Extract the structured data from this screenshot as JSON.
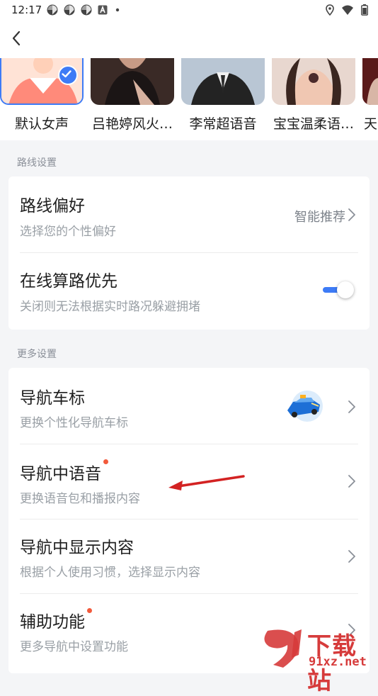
{
  "status_bar": {
    "time": "12:17",
    "left_icons": [
      "pinwheel-icon",
      "pinwheel-icon",
      "pinwheel-icon",
      "a-square-icon",
      "dot-icon"
    ],
    "right_icons": [
      "location-icon",
      "wifi-icon",
      "battery-icon"
    ]
  },
  "voices": [
    {
      "label": "默认女声",
      "selected": true
    },
    {
      "label": "吕艳婷风火…",
      "selected": false
    },
    {
      "label": "李常超语音",
      "selected": false
    },
    {
      "label": "宝宝温柔语…",
      "selected": false
    },
    {
      "label": "天",
      "selected": false
    }
  ],
  "route_section": {
    "title": "路线设置",
    "preference": {
      "title": "路线偏好",
      "subtitle": "选择您的个性偏好",
      "value": "智能推荐"
    },
    "online": {
      "title": "在线算路优先",
      "subtitle": "关闭则无法根据实时路况躲避拥堵",
      "enabled": true
    }
  },
  "more_section": {
    "title": "更多设置",
    "car_marker": {
      "title": "导航车标",
      "subtitle": "更换个性化导航车标"
    },
    "voice": {
      "title": "导航中语音",
      "subtitle": "更换语音包和播报内容",
      "has_dot": true
    },
    "display": {
      "title": "导航中显示内容",
      "subtitle": "根据个人使用习惯，选择显示内容"
    },
    "assist": {
      "title": "辅助功能",
      "subtitle": "更多导航中设置功能",
      "has_dot": true
    }
  },
  "watermark": {
    "title": "下载站",
    "subtitle": "91xz.net"
  },
  "colors": {
    "accent": "#3d7bf6",
    "dot": "#f25a3c",
    "watermark": "#d63b3b"
  }
}
